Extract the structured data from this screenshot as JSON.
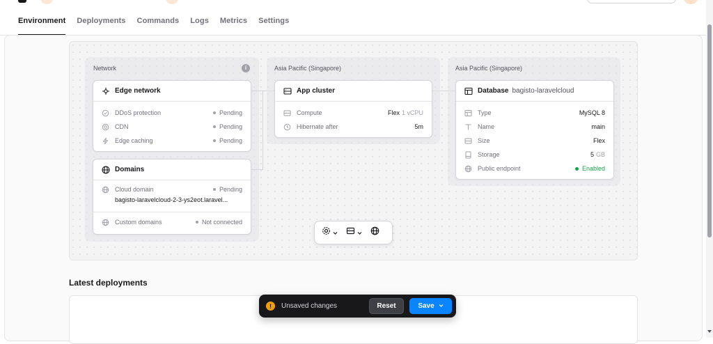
{
  "tabs": [
    {
      "label": "Environment",
      "active": true
    },
    {
      "label": "Deployments"
    },
    {
      "label": "Commands"
    },
    {
      "label": "Logs"
    },
    {
      "label": "Metrics"
    },
    {
      "label": "Settings"
    }
  ],
  "network": {
    "group_label": "Network",
    "info_icon": "info-icon",
    "edge": {
      "title": "Edge network",
      "rows": [
        {
          "icon": "shield-icon",
          "label": "DDoS protection",
          "value": "Pending"
        },
        {
          "icon": "cdn-icon",
          "label": "CDN",
          "value": "Pending"
        },
        {
          "icon": "bolt-icon",
          "label": "Edge caching",
          "value": "Pending"
        }
      ]
    },
    "domains": {
      "title": "Domains",
      "cloud_label": "Cloud domain",
      "cloud_value": "Pending",
      "cloud_domain": "bagisto-laravelcloud-2-3-ys2eot.laravel...",
      "custom_label": "Custom domains",
      "custom_value": "Not connected"
    }
  },
  "compute": {
    "group_label": "Asia Pacific (Singapore)",
    "title": "App cluster",
    "rows": [
      {
        "icon": "server-icon",
        "label": "Compute",
        "value": "Flex",
        "muted": "1 vCPU"
      },
      {
        "icon": "clock-icon",
        "label": "Hibernate after",
        "value": "5m"
      }
    ]
  },
  "database": {
    "group_label": "Asia Pacific (Singapore)",
    "title": "Database",
    "subtitle": "bagisto-laravelcloud",
    "rows": [
      {
        "icon": "table-icon",
        "label": "Type",
        "value": "MySQL 8"
      },
      {
        "icon": "text-icon",
        "label": "Name",
        "value": "main"
      },
      {
        "icon": "server-icon",
        "label": "Size",
        "value": "Flex"
      },
      {
        "icon": "disk-icon",
        "label": "Storage",
        "value": "5",
        "muted": "GB"
      },
      {
        "icon": "globe-icon",
        "label": "Public endpoint",
        "value": "Enabled"
      }
    ]
  },
  "toolbar": {
    "settings_icon": "gear-icon",
    "cluster_icon": "server-icon",
    "globe_icon": "globe-icon"
  },
  "latest": {
    "title": "Latest deployments"
  },
  "unsaved": {
    "message": "Unsaved changes",
    "reset_label": "Reset",
    "save_label": "Save"
  },
  "colors": {
    "accent": "#0a84ff",
    "success": "#16a34a",
    "warning": "#f59e0b"
  }
}
